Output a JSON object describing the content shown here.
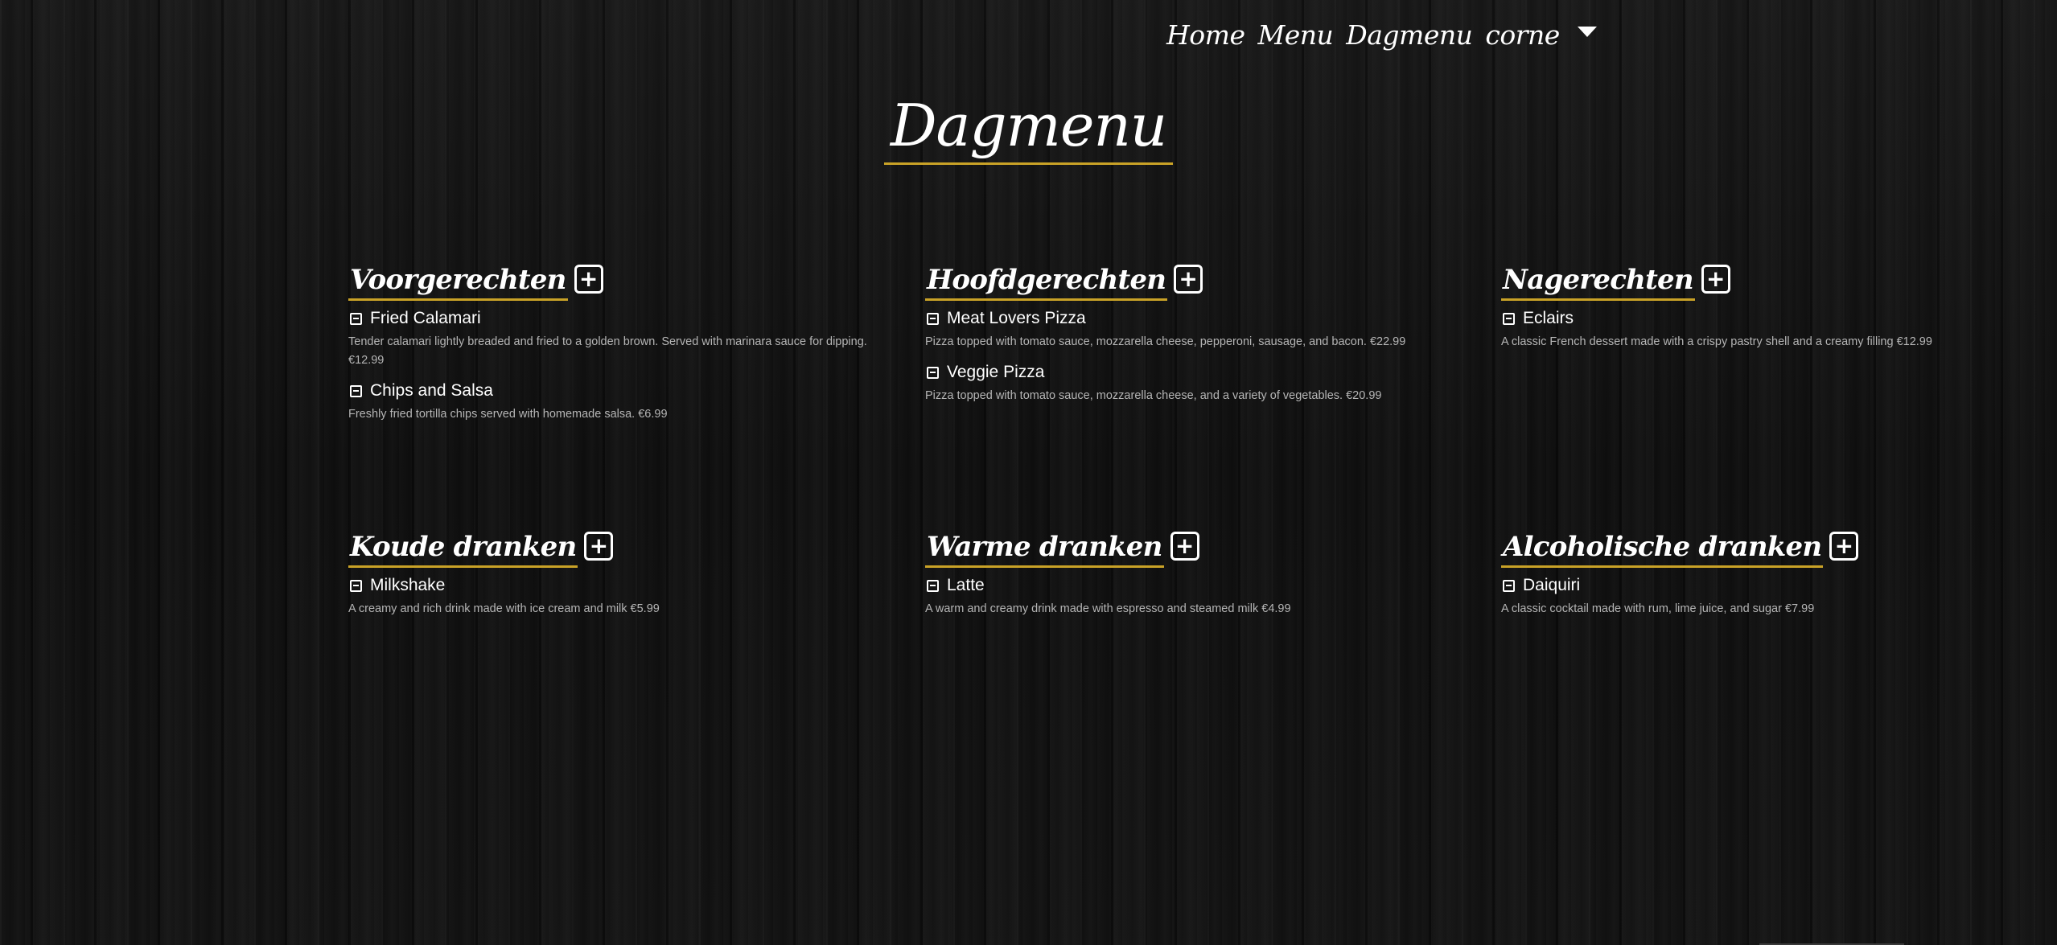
{
  "nav": {
    "home": "Home",
    "menu": "Menu",
    "dagmenu": "Dagmenu",
    "user": "corne"
  },
  "page": {
    "title": "Dagmenu"
  },
  "icons": {
    "add": "plus-square-icon",
    "remove": "minus-square-icon",
    "dropdown": "caret-down-icon"
  },
  "colors": {
    "accent_underline": "#c9a227",
    "text": "#ffffff",
    "description": "#b5b5b5",
    "background": "#0c0c0c"
  },
  "sections": {
    "voorgerechten": {
      "title": "Voorgerechten",
      "add_symbol": "+",
      "items": [
        {
          "name": "Fried Calamari",
          "description": "Tender calamari lightly breaded and fried to a golden brown. Served with marinara sauce for dipping. €12.99"
        },
        {
          "name": "Chips and Salsa",
          "description": "Freshly fried tortilla chips served with homemade salsa. €6.99"
        }
      ]
    },
    "hoofdgerechten": {
      "title": "Hoofdgerechten",
      "add_symbol": "+",
      "items": [
        {
          "name": "Meat Lovers Pizza",
          "description": "Pizza topped with tomato sauce, mozzarella cheese, pepperoni, sausage, and bacon. €22.99"
        },
        {
          "name": "Veggie Pizza",
          "description": "Pizza topped with tomato sauce, mozzarella cheese, and a variety of vegetables. €20.99"
        }
      ]
    },
    "nagerechten": {
      "title": "Nagerechten",
      "add_symbol": "+",
      "items": [
        {
          "name": "Eclairs",
          "description": "A classic French dessert made with a crispy pastry shell and a creamy filling €12.99"
        }
      ]
    },
    "koude_dranken": {
      "title": "Koude dranken",
      "add_symbol": "+",
      "items": [
        {
          "name": "Milkshake",
          "description": "A creamy and rich drink made with ice cream and milk €5.99"
        }
      ]
    },
    "warme_dranken": {
      "title": "Warme dranken",
      "add_symbol": "+",
      "items": [
        {
          "name": "Latte",
          "description": "A warm and creamy drink made with espresso and steamed milk €4.99"
        }
      ]
    },
    "alcoholische_dranken": {
      "title": "Alcoholische dranken",
      "add_symbol": "+",
      "items": [
        {
          "name": "Daiquiri",
          "description": "A classic cocktail made with rum, lime juice, and sugar €7.99"
        }
      ]
    }
  }
}
